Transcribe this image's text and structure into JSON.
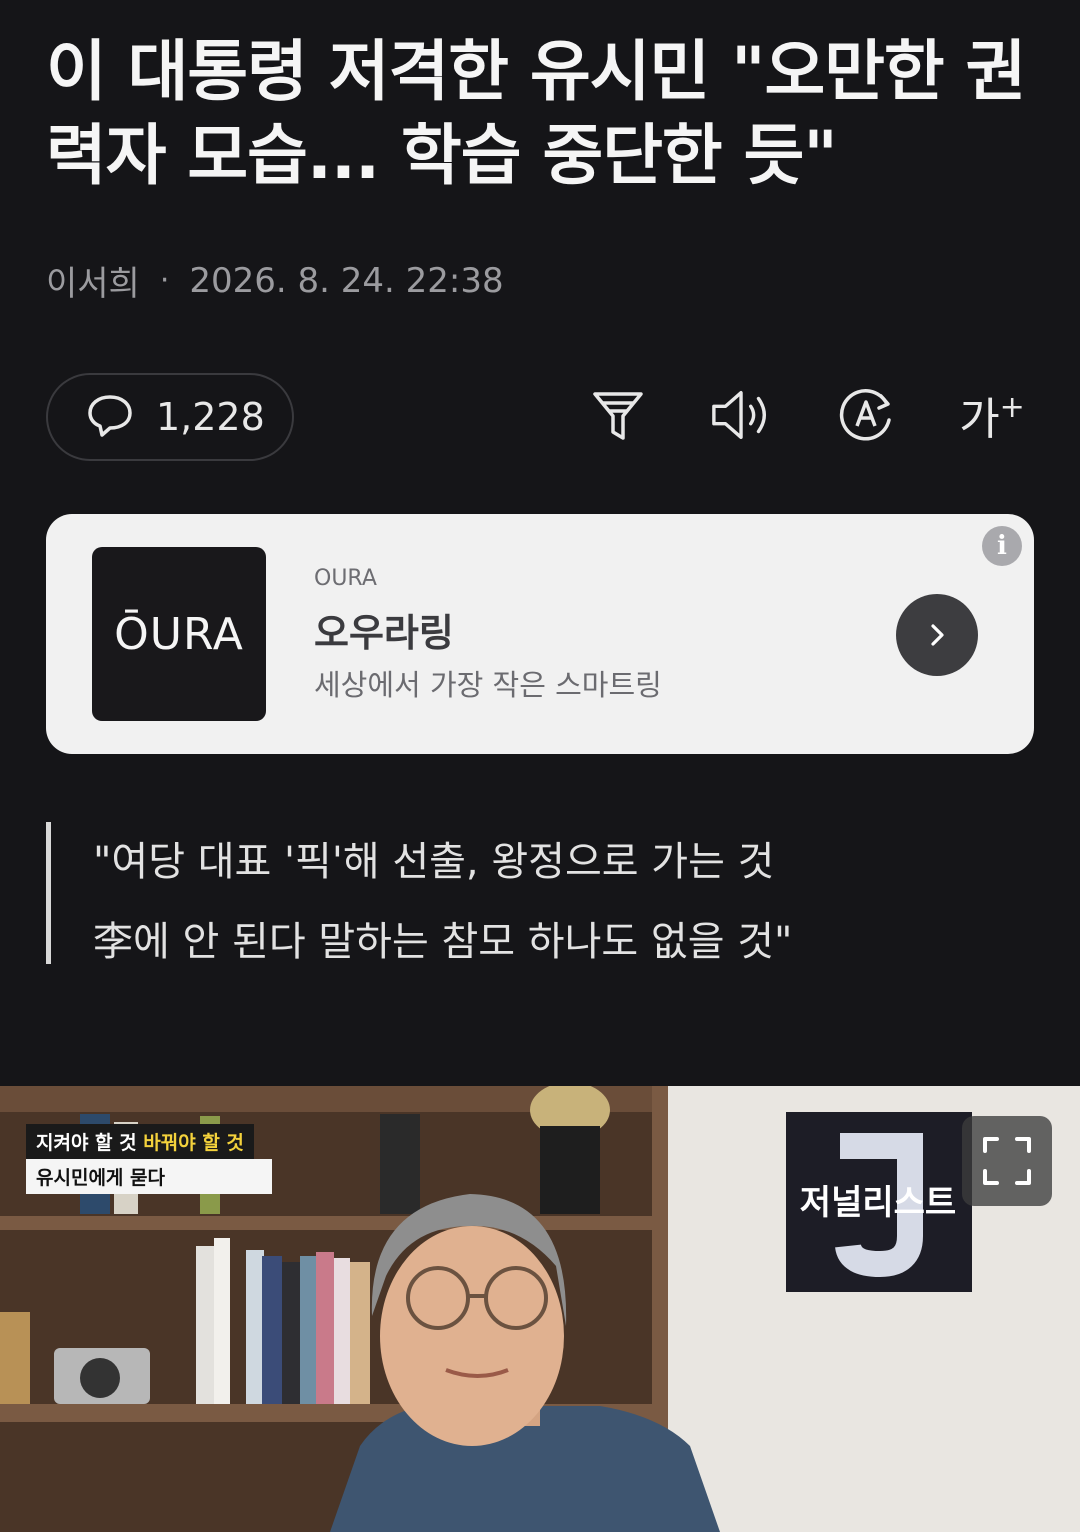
{
  "article": {
    "headline": "이 대통령 저격한 유시민 \"오만한 권력자 모습... 학습 중단한 듯\"",
    "author": "이서희",
    "separator": "·",
    "datetime": "2026. 8. 24. 22:38"
  },
  "toolbar": {
    "comment_count": "1,228",
    "font_size_label": "가",
    "font_size_plus": "+"
  },
  "ad": {
    "logo_text": "ŌURA",
    "brand": "OURA",
    "title": "오우라링",
    "description": "세상에서 가장 작은 스마트링",
    "info_label": "i"
  },
  "quote": {
    "line1": "\"여당 대표 '픽'해 선출, 왕정으로 가는 것",
    "line2": "李에 안 된다 말하는 참모 하나도 없을 것\""
  },
  "photo": {
    "caption_part1": "지켜야 할 것",
    "caption_part2": "바꿔야 할 것",
    "caption_line2": "유시민에게 묻다",
    "sign_text": "저널리스트",
    "sign_letter": "J"
  },
  "colors": {
    "background": "#151518",
    "ad_card": "#f1f1f1",
    "caption_highlight": "#f4d23c"
  }
}
